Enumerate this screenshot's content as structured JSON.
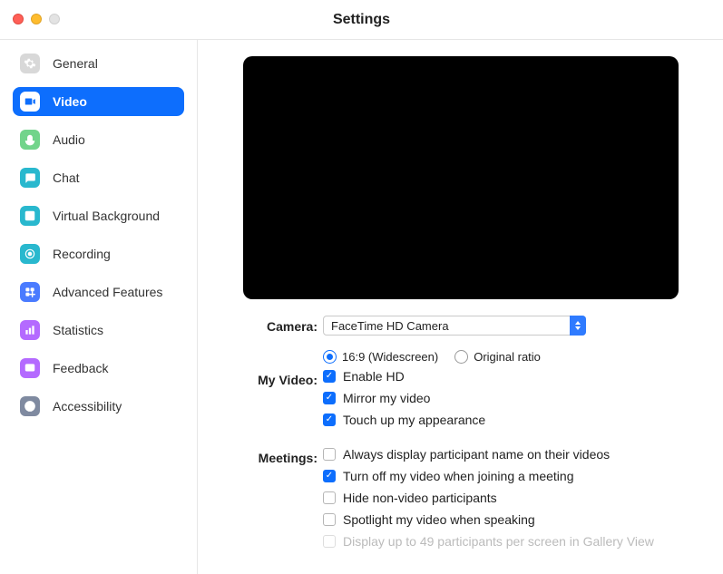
{
  "window": {
    "title": "Settings"
  },
  "sidebar": {
    "items": [
      {
        "id": "general",
        "label": "General",
        "icon_bg": "#d8d8d8",
        "icon_fg": "#fff"
      },
      {
        "id": "video",
        "label": "Video",
        "icon_bg": "#ffffff",
        "icon_fg": "#0d6efd"
      },
      {
        "id": "audio",
        "label": "Audio",
        "icon_bg": "#72d48b",
        "icon_fg": "#fff"
      },
      {
        "id": "chat",
        "label": "Chat",
        "icon_bg": "#29b8ce",
        "icon_fg": "#fff"
      },
      {
        "id": "virtual-background",
        "label": "Virtual Background",
        "icon_bg": "#29b8ce",
        "icon_fg": "#fff"
      },
      {
        "id": "recording",
        "label": "Recording",
        "icon_bg": "#29b8ce",
        "icon_fg": "#fff"
      },
      {
        "id": "advanced-features",
        "label": "Advanced Features",
        "icon_bg": "#4a7bff",
        "icon_fg": "#fff"
      },
      {
        "id": "statistics",
        "label": "Statistics",
        "icon_bg": "#b46aff",
        "icon_fg": "#fff"
      },
      {
        "id": "feedback",
        "label": "Feedback",
        "icon_bg": "#b46aff",
        "icon_fg": "#fff"
      },
      {
        "id": "accessibility",
        "label": "Accessibility",
        "icon_bg": "#7f8aa0",
        "icon_fg": "#fff"
      }
    ],
    "active": "video"
  },
  "main": {
    "camera_label": "Camera:",
    "camera_selected": "FaceTime HD Camera",
    "ratio": {
      "widescreen": "16:9 (Widescreen)",
      "original": "Original ratio",
      "selected": "widescreen"
    },
    "my_video_label": "My Video:",
    "my_video": [
      {
        "id": "enable-hd",
        "label": "Enable HD",
        "checked": true
      },
      {
        "id": "mirror",
        "label": "Mirror my video",
        "checked": true
      },
      {
        "id": "touch-up",
        "label": "Touch up my appearance",
        "checked": true
      }
    ],
    "meetings_label": "Meetings:",
    "meetings": [
      {
        "id": "display-name",
        "label": "Always display participant name on their videos",
        "checked": false,
        "disabled": false
      },
      {
        "id": "turn-off-join",
        "label": "Turn off my video when joining a meeting",
        "checked": true,
        "disabled": false
      },
      {
        "id": "hide-non-video",
        "label": "Hide non-video participants",
        "checked": false,
        "disabled": false
      },
      {
        "id": "spotlight-speaking",
        "label": "Spotlight my video when speaking",
        "checked": false,
        "disabled": false
      },
      {
        "id": "gallery-49",
        "label": "Display up to 49 participants per screen in Gallery View",
        "checked": false,
        "disabled": true
      }
    ]
  }
}
